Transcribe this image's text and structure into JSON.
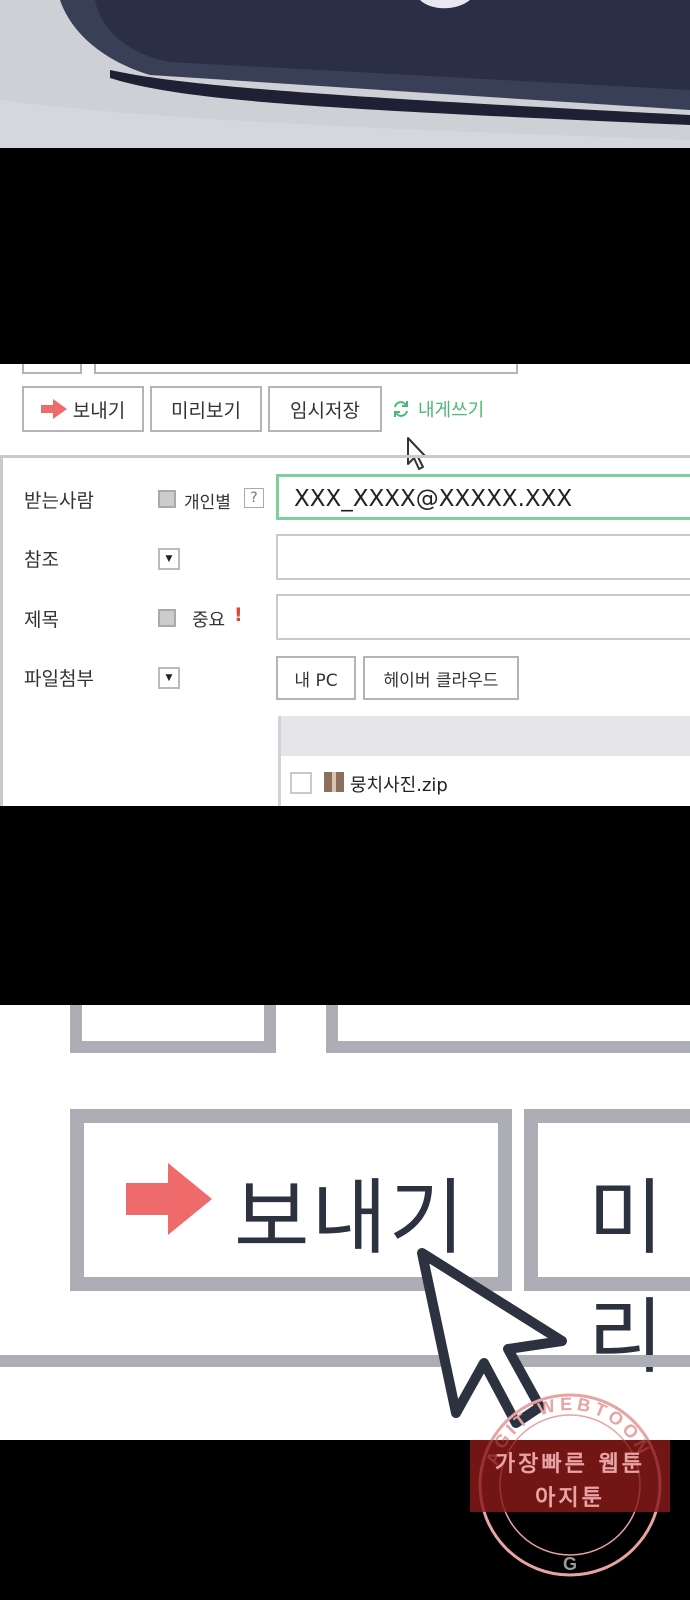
{
  "toolbar": {
    "send_label": "보내기",
    "preview_label": "미리보기",
    "draft_label": "임시저장",
    "self_mail_label": "내게쓰기"
  },
  "fields": {
    "recipient_label": "받는사람",
    "individual_label": "개인별",
    "help_mark": "?",
    "recipient_value": "XXX_XXXX@XXXXX.XXX",
    "cc_label": "참조",
    "subject_label": "제목",
    "important_label": "중요",
    "important_mark": "!",
    "attach_label": "파일첨부",
    "my_pc_label": "내 PC",
    "cloud_label": "헤이버 클라우드",
    "attached_file": "뭉치사진.zip"
  },
  "zoom": {
    "send_label": "보내기",
    "preview_partial": "미리"
  },
  "watermark": {
    "ring_text": "AGIT WEBTOON",
    "line1": "가장빠른 웹툰",
    "line2": "아지툰"
  },
  "colors": {
    "send_arrow": "#ef6b6b",
    "recipient_border": "#7fcf9a",
    "self_mail": "#4bb877",
    "important_mark": "#e0433a",
    "button_border": "#b3b3b8"
  }
}
